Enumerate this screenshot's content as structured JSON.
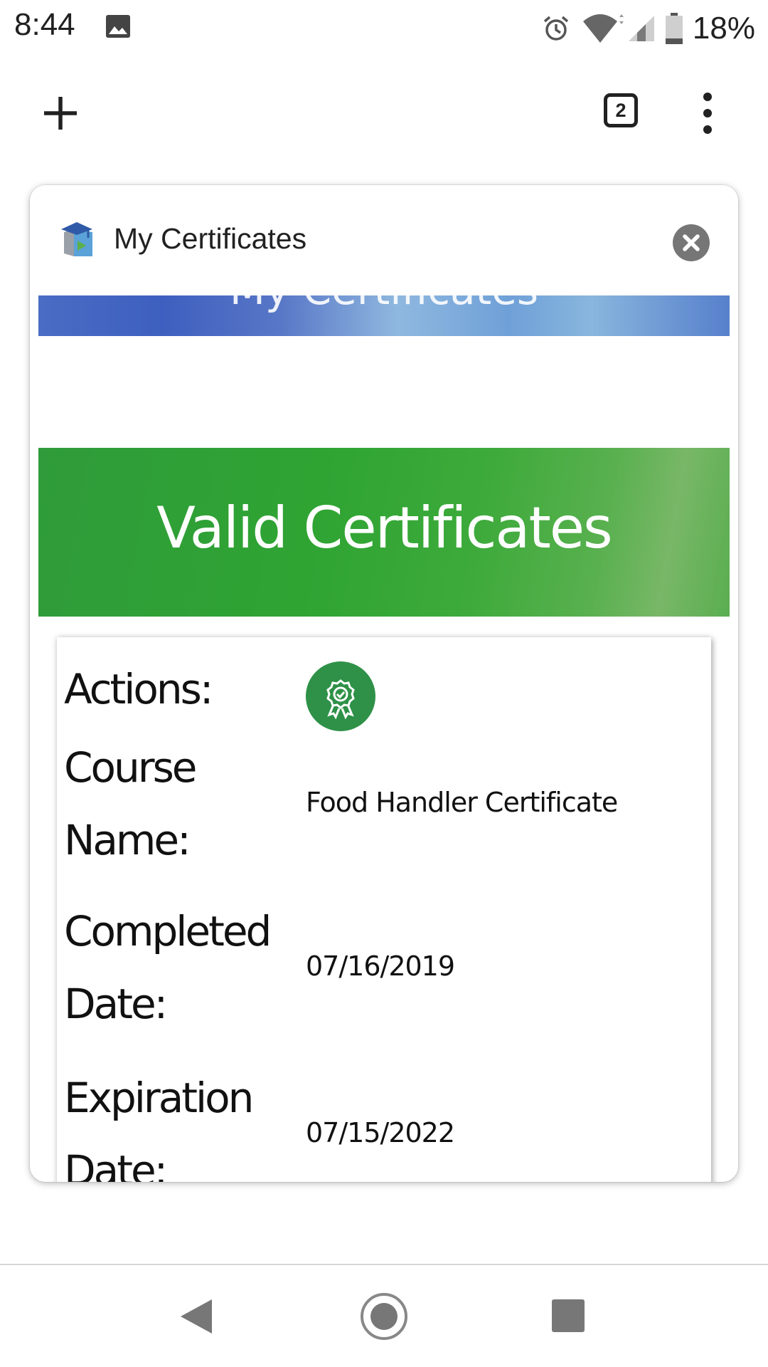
{
  "status_bar": {
    "time": "8:44",
    "battery_percent": "18%",
    "icons": [
      "image-notification-icon",
      "alarm-icon",
      "wifi-icon",
      "cell-signal-icon",
      "battery-icon"
    ]
  },
  "browser": {
    "new_tab_icon": "plus-icon",
    "tab_count": "2",
    "menu_icon": "more-vert-icon"
  },
  "popup": {
    "title": "My Certificates",
    "logo_icon": "graduation-book-icon",
    "close_icon": "close-icon",
    "banner_heading": "My Certificates",
    "section_heading": "Valid Certificates",
    "certificate": {
      "actions_label": "Actions:",
      "action_icon": "award-ribbon-icon",
      "course_name_label": "Course Name:",
      "course_name": "Food Handler Certificate",
      "completed_date_label": "Completed Date:",
      "completed_date": "07/16/2019",
      "expiration_label": "Expiration Date:",
      "expiration_date": "07/15/2022"
    }
  },
  "colors": {
    "green_banner": "#2fa433",
    "blue_banner": "#4a6cc4",
    "award_button": "#2e9147",
    "close_button": "#767676"
  },
  "nav_bar": {
    "icons": [
      "back-icon",
      "home-icon",
      "recents-icon"
    ]
  }
}
